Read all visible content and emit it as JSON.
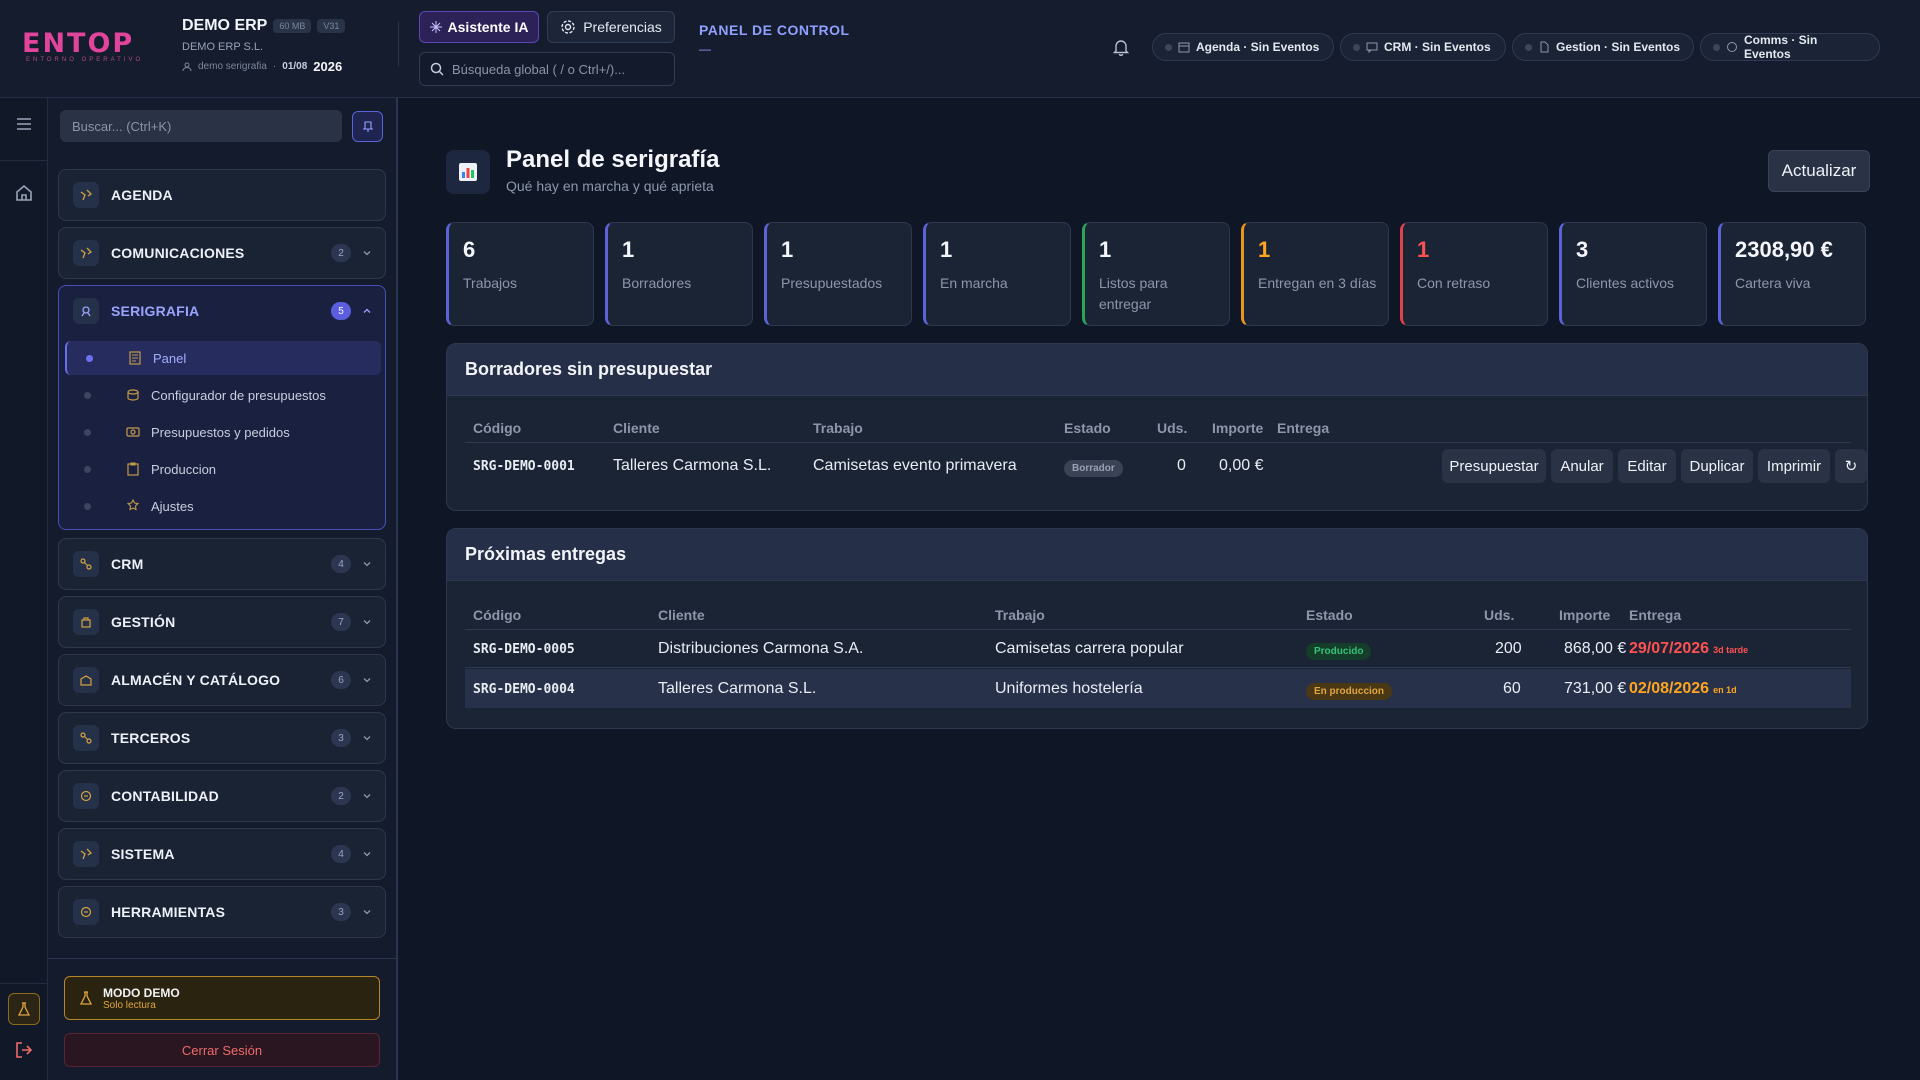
{
  "brand": {
    "logo": "ENTOP",
    "logo_sub": "ENTORNO OPERATIVO",
    "logo_color": "#e0459b"
  },
  "company": {
    "name": "DEMO ERP",
    "size_badge": "60 MB",
    "version_badge": "V31",
    "legal_name": "DEMO ERP S.L.",
    "user": "demo serigrafia",
    "date": "01/08",
    "year": "2026"
  },
  "header": {
    "ai_button": "Asistente IA",
    "prefs_button": "Preferencias",
    "search_placeholder": "Búsqueda global ( / o Ctrl+/)...",
    "panel_link": "PANEL DE CONTROL",
    "panel_link_sub": "—",
    "status_pills": [
      {
        "label": "Agenda · Sin Eventos",
        "icon": "calendar-icon"
      },
      {
        "label": "CRM · Sin Eventos",
        "icon": "chat-icon"
      },
      {
        "label": "Gestion · Sin Eventos",
        "icon": "document-icon"
      },
      {
        "label": "Comms · Sin Eventos",
        "icon": "bubble-icon"
      }
    ]
  },
  "sidebar": {
    "search_placeholder": "Buscar... (Ctrl+K)",
    "groups": [
      {
        "label": "AGENDA",
        "count": ""
      },
      {
        "label": "COMUNICACIONES",
        "count": "2"
      },
      {
        "label": "SERIGRAFIA",
        "count": "5",
        "open": true
      },
      {
        "label": "CRM",
        "count": "4"
      },
      {
        "label": "GESTIÓN",
        "count": "7"
      },
      {
        "label": "ALMACÉN Y CATÁLOGO",
        "count": "6"
      },
      {
        "label": "TERCEROS",
        "count": "3"
      },
      {
        "label": "CONTABILIDAD",
        "count": "2"
      },
      {
        "label": "SISTEMA",
        "count": "4"
      },
      {
        "label": "HERRAMIENTAS",
        "count": "3"
      }
    ],
    "sub_items": [
      {
        "label": "Panel",
        "active": true
      },
      {
        "label": "Configurador de presupuestos"
      },
      {
        "label": "Presupuestos y pedidos"
      },
      {
        "label": "Produccion"
      },
      {
        "label": "Ajustes"
      }
    ],
    "demo_title": "MODO DEMO",
    "demo_sub": "Solo lectura",
    "logout": "Cerrar Sesión"
  },
  "page": {
    "title": "Panel de serigrafía",
    "subtitle": "Qué hay en marcha y qué aprieta",
    "refresh": "Actualizar"
  },
  "kpis": [
    {
      "value": "6",
      "label": "Trabajos",
      "accent": "#5b63d6",
      "value_color": "#f4f6fb"
    },
    {
      "value": "1",
      "label": "Borradores",
      "accent": "#5b63d6",
      "value_color": "#f4f6fb"
    },
    {
      "value": "1",
      "label": "Presupuestados",
      "accent": "#5b63d6",
      "value_color": "#f4f6fb"
    },
    {
      "value": "1",
      "label": "En marcha",
      "accent": "#5b63d6",
      "value_color": "#f4f6fb"
    },
    {
      "value": "1",
      "label": "Listos para entregar",
      "accent": "#2ea35a",
      "value_color": "#f4f6fb"
    },
    {
      "value": "1",
      "label": "Entregan en 3 días",
      "accent": "#e8961c",
      "value_color": "#ffa51f"
    },
    {
      "value": "1",
      "label": "Con retraso",
      "accent": "#e0424a",
      "value_color": "#ff5151"
    },
    {
      "value": "3",
      "label": "Clientes activos",
      "accent": "#5b63d6",
      "value_color": "#f4f6fb"
    },
    {
      "value": "2308,90 €",
      "label": "Cartera viva",
      "accent": "#5b63d6",
      "value_color": "#f4f6fb"
    }
  ],
  "drafts": {
    "title": "Borradores sin presupuestar",
    "headers": {
      "code": "Código",
      "client": "Cliente",
      "job": "Trabajo",
      "status": "Estado",
      "units": "Uds.",
      "amount": "Importe",
      "delivery": "Entrega"
    },
    "rows": [
      {
        "code": "SRG-DEMO-0001",
        "client": "Talleres Carmona S.L.",
        "job": "Camisetas evento primavera",
        "status": "Borrador",
        "units": "0",
        "amount": "0,00 €"
      }
    ],
    "actions": {
      "quote": "Presupuestar",
      "cancel": "Anular",
      "edit": "Editar",
      "duplicate": "Duplicar",
      "print": "Imprimir",
      "reload": "↻"
    }
  },
  "deliveries": {
    "title": "Próximas entregas",
    "headers": {
      "code": "Código",
      "client": "Cliente",
      "job": "Trabajo",
      "status": "Estado",
      "units": "Uds.",
      "amount": "Importe",
      "delivery": "Entrega"
    },
    "rows": [
      {
        "code": "SRG-DEMO-0005",
        "client": "Distribuciones Carmona S.A.",
        "job": "Camisetas carrera popular",
        "status": "Producido",
        "units": "200",
        "amount": "868,00 €",
        "date": "29/07/2026",
        "note": "3d tarde"
      },
      {
        "code": "SRG-DEMO-0004",
        "client": "Talleres Carmona S.L.",
        "job": "Uniformes hostelería",
        "status": "En produccion",
        "units": "60",
        "amount": "731,00 €",
        "date": "02/08/2026",
        "note": "en 1d"
      }
    ]
  }
}
